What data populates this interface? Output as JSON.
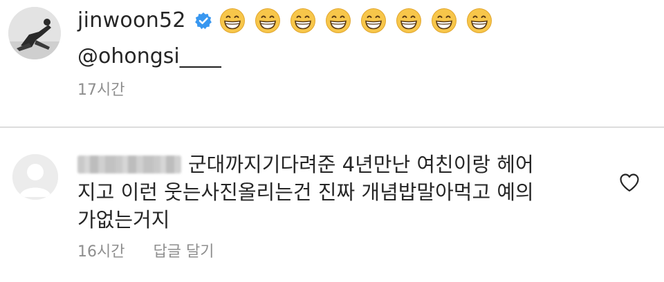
{
  "caption": {
    "username": "jinwoon52",
    "verified_icon": "verified-badge-icon",
    "emoji_icons": [
      "grinning-face-emoji",
      "grinning-face-emoji",
      "grinning-face-emoji",
      "grinning-face-emoji",
      "grinning-face-emoji",
      "grinning-face-emoji",
      "grinning-face-emoji",
      "grinning-face-emoji"
    ],
    "mention": "@ohongsi____",
    "time": "17시간"
  },
  "comment": {
    "lines": [
      "군대까지기다려준 4년만난 여친이랑 헤어",
      "지고 이런 웃는사진올리는건 진짜 개념밥말아먹고 예의",
      "가없는거지"
    ],
    "time": "16시간",
    "reply_label": "답글 달기",
    "like_icon": "heart-outline-icon"
  },
  "colors": {
    "text": "#262626",
    "secondary": "#8e8e8e",
    "verified": "#3897f0",
    "divider": "#dcdcdc"
  }
}
